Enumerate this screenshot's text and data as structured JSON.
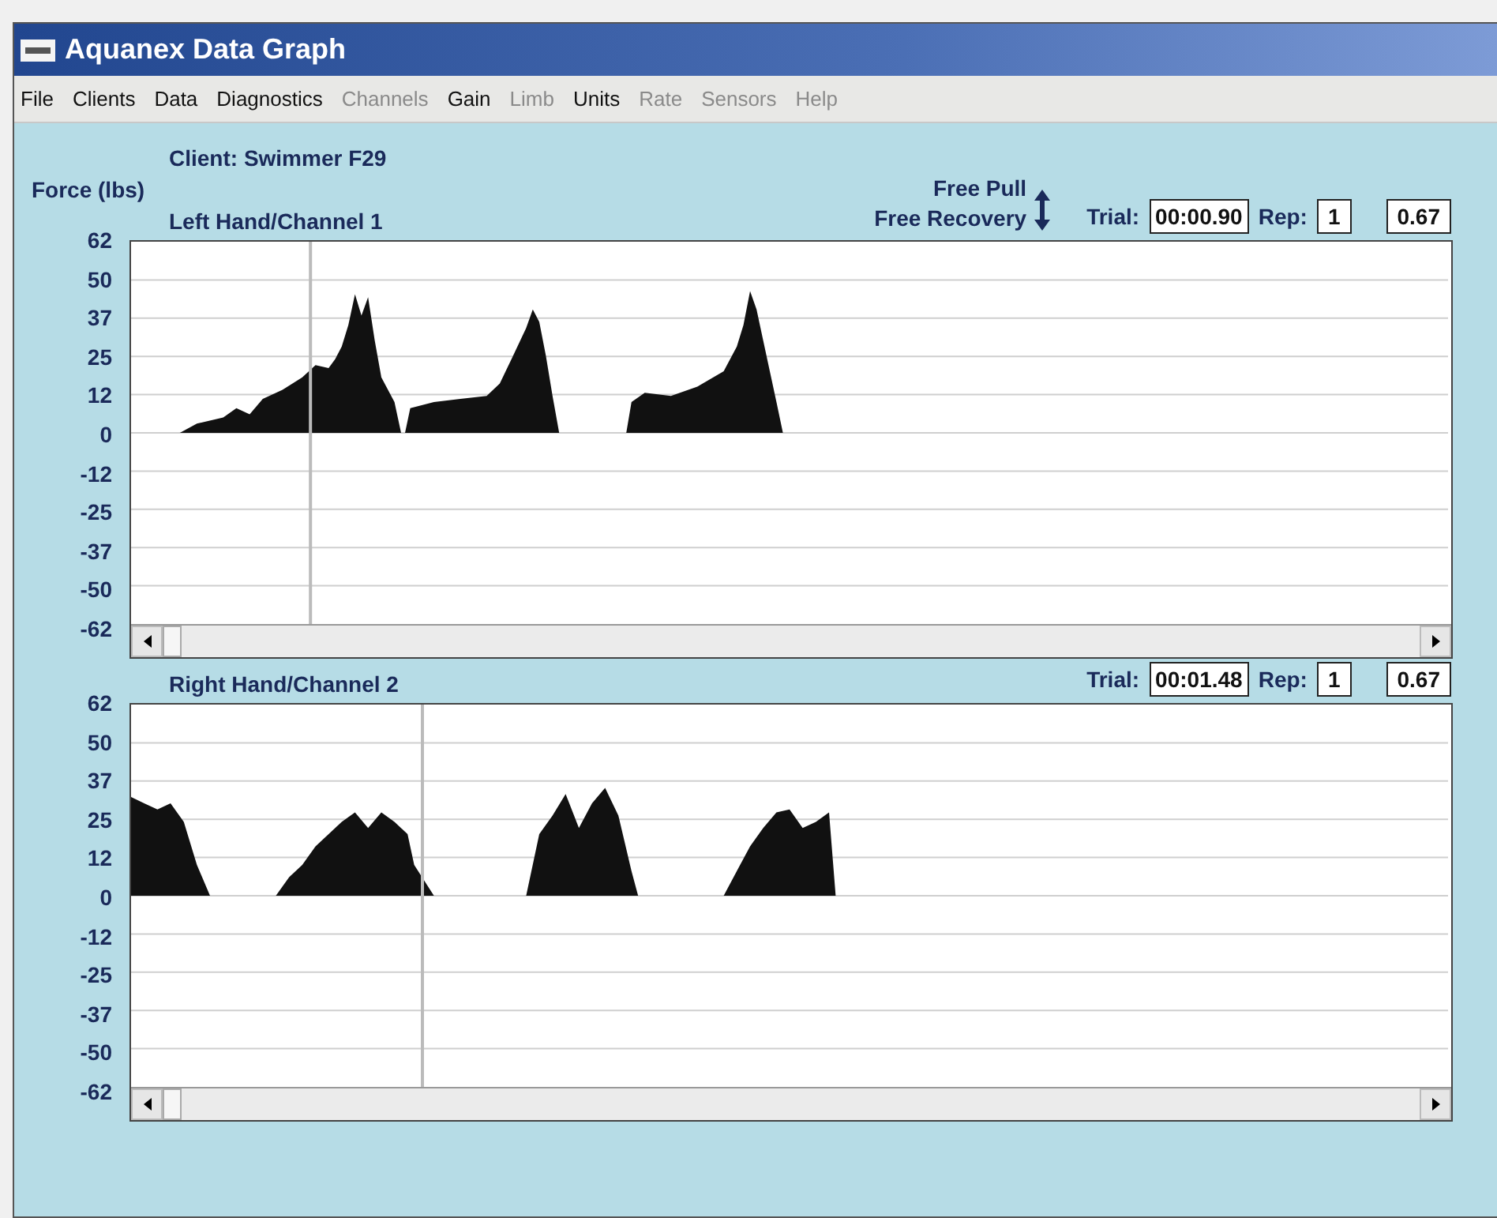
{
  "window": {
    "title": "Aquanex Data Graph"
  },
  "menu": [
    {
      "label": "File",
      "disabled": false
    },
    {
      "label": "Clients",
      "disabled": false
    },
    {
      "label": "Data",
      "disabled": false
    },
    {
      "label": "Diagnostics",
      "disabled": false
    },
    {
      "label": "Channels",
      "disabled": true
    },
    {
      "label": "Gain",
      "disabled": false
    },
    {
      "label": "Limb",
      "disabled": true
    },
    {
      "label": "Units",
      "disabled": false
    },
    {
      "label": "Rate",
      "disabled": true
    },
    {
      "label": "Sensors",
      "disabled": true
    },
    {
      "label": "Help",
      "disabled": true
    }
  ],
  "client": "Client: Swimmer F29",
  "y_axis_title": "Force (lbs)",
  "mode": [
    "Free Pull",
    "Free Recovery"
  ],
  "panels": [
    {
      "title": "Left Hand/Channel 1",
      "trial_label": "Trial:",
      "trial": "00:00.90",
      "rep_label": "Rep:",
      "rep": "1",
      "value": "0.67",
      "y_labels": [
        "62",
        "50",
        "37",
        "25",
        "12",
        "0",
        "-12",
        "-25",
        "-37",
        "-50",
        "-62"
      ]
    },
    {
      "title": "Right Hand/Channel 2",
      "trial_label": "Trial:",
      "trial": "00:01.48",
      "rep_label": "Rep:",
      "rep": "1",
      "value": "0.67",
      "y_labels": [
        "62",
        "50",
        "37",
        "25",
        "12",
        "0",
        "-12",
        "-25",
        "-37",
        "-50",
        "-62"
      ]
    }
  ]
}
